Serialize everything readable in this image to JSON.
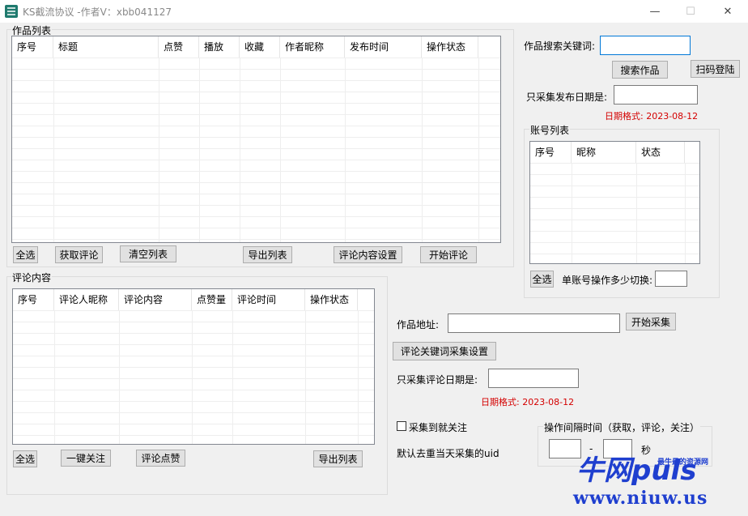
{
  "window": {
    "title": "KS截流协议 -作者V：xbb041127",
    "minimize_icon": "—",
    "maximize_icon": "☐",
    "close_icon": "✕"
  },
  "works": {
    "group_label": "作品列表",
    "columns": [
      "序号",
      "标题",
      "点赞",
      "播放",
      "收藏",
      "作者昵称",
      "发布时间",
      "操作状态"
    ],
    "buttons": {
      "select_all": "全选",
      "get_comments": "获取评论",
      "clear_list": "清空列表",
      "export_list": "导出列表",
      "comment_settings": "评论内容设置",
      "start_comment": "开始评论"
    }
  },
  "search": {
    "keyword_label": "作品搜索关键词:",
    "keyword_value": "",
    "search_button": "搜索作品",
    "scan_login_button": "扫码登陆",
    "date_label": "只采集发布日期是:",
    "date_value": "",
    "date_format_hint": "日期格式: 2023-08-12"
  },
  "accounts": {
    "group_label": "账号列表",
    "columns": [
      "序号",
      "昵称",
      "状态"
    ],
    "select_all": "全选",
    "switch_label": "单账号操作多少切换:",
    "switch_value": ""
  },
  "comments": {
    "group_label": "评论内容",
    "columns": [
      "序号",
      "评论人昵称",
      "评论内容",
      "点赞量",
      "评论时间",
      "操作状态"
    ],
    "buttons": {
      "select_all": "全选",
      "follow_all": "一键关注",
      "like_comments": "评论点赞",
      "export_list": "导出列表"
    }
  },
  "collect": {
    "url_label": "作品地址:",
    "url_value": "",
    "start_collect": "开始采集",
    "keyword_settings": "评论关键词采集设置",
    "comment_date_label": "只采集评论日期是:",
    "comment_date_value": "",
    "date_format_hint": "日期格式: 2023-08-12",
    "follow_checkbox_label": "采集到就关注",
    "dedupe_label": "默认去重当天采集的uid"
  },
  "interval": {
    "group_label": "操作间隔时间（获取，评论，关注）",
    "min_value": "",
    "separator": "-",
    "max_value": "",
    "unit": "秒"
  },
  "watermark": {
    "logo": "牛网puls",
    "tagline": "最牛最的资源网",
    "url": "www.niuw.us"
  }
}
